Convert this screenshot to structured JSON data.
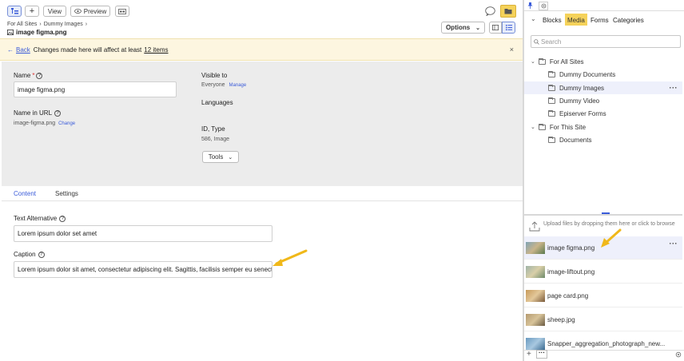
{
  "toolbar": {
    "view_label": "View",
    "preview_label": "Preview",
    "options_label": "Options"
  },
  "breadcrumb": {
    "items": [
      "For All Sites",
      "Dummy Images"
    ],
    "title": "image figma.png"
  },
  "notice": {
    "back_label": "Back",
    "message": "Changes made here will affect at least",
    "count_link": "12 items"
  },
  "properties": {
    "name_label": "Name",
    "name_required": "*",
    "name_value": "image figma.png",
    "url_label": "Name in URL",
    "url_value": "image-figma.png",
    "url_change": "Change",
    "visible_label": "Visible to",
    "visible_value": "Everyone",
    "visible_manage": "Manage",
    "languages_label": "Languages",
    "id_label": "ID, Type",
    "id_value": "586, Image",
    "tools_label": "Tools"
  },
  "tabs": {
    "content": "Content",
    "settings": "Settings"
  },
  "content": {
    "alt_label": "Text Alternative",
    "alt_value": "Lorem ipsum dolor set amet",
    "caption_label": "Caption",
    "caption_value": "Lorem ipsum dolor sit amet, consectetur adipiscing elit. Sagittis, facilisis semper eu senectus"
  },
  "right_panel": {
    "tabs": [
      "Blocks",
      "Media",
      "Forms",
      "Categories"
    ],
    "active_tab": "Media",
    "search_placeholder": "Search",
    "tree": [
      {
        "label": "For All Sites",
        "level": 0,
        "expanded": true
      },
      {
        "label": "Dummy Documents",
        "level": 1
      },
      {
        "label": "Dummy Images",
        "level": 1,
        "selected": true
      },
      {
        "label": "Dummy Video",
        "level": 1
      },
      {
        "label": "Episerver Forms",
        "level": 1
      },
      {
        "label": "For This Site",
        "level": 0,
        "expanded": true
      },
      {
        "label": "Documents",
        "level": 1
      }
    ],
    "upload_text": "Upload files by dropping them here or click to browse",
    "media": [
      {
        "name": "image figma.png",
        "selected": true
      },
      {
        "name": "image-liftout.png"
      },
      {
        "name": "page card.png"
      },
      {
        "name": "sheep.jpg"
      },
      {
        "name": "Snapper_aggregation_photograph_new..."
      }
    ]
  },
  "colors": {
    "accent_yellow": "#f5d25a",
    "notice_bg": "#fdf6e0",
    "props_bg": "#ececec",
    "selected_bg": "#eef0fb",
    "link_blue": "#3a5bd9",
    "arrow": "#f0b81a"
  }
}
